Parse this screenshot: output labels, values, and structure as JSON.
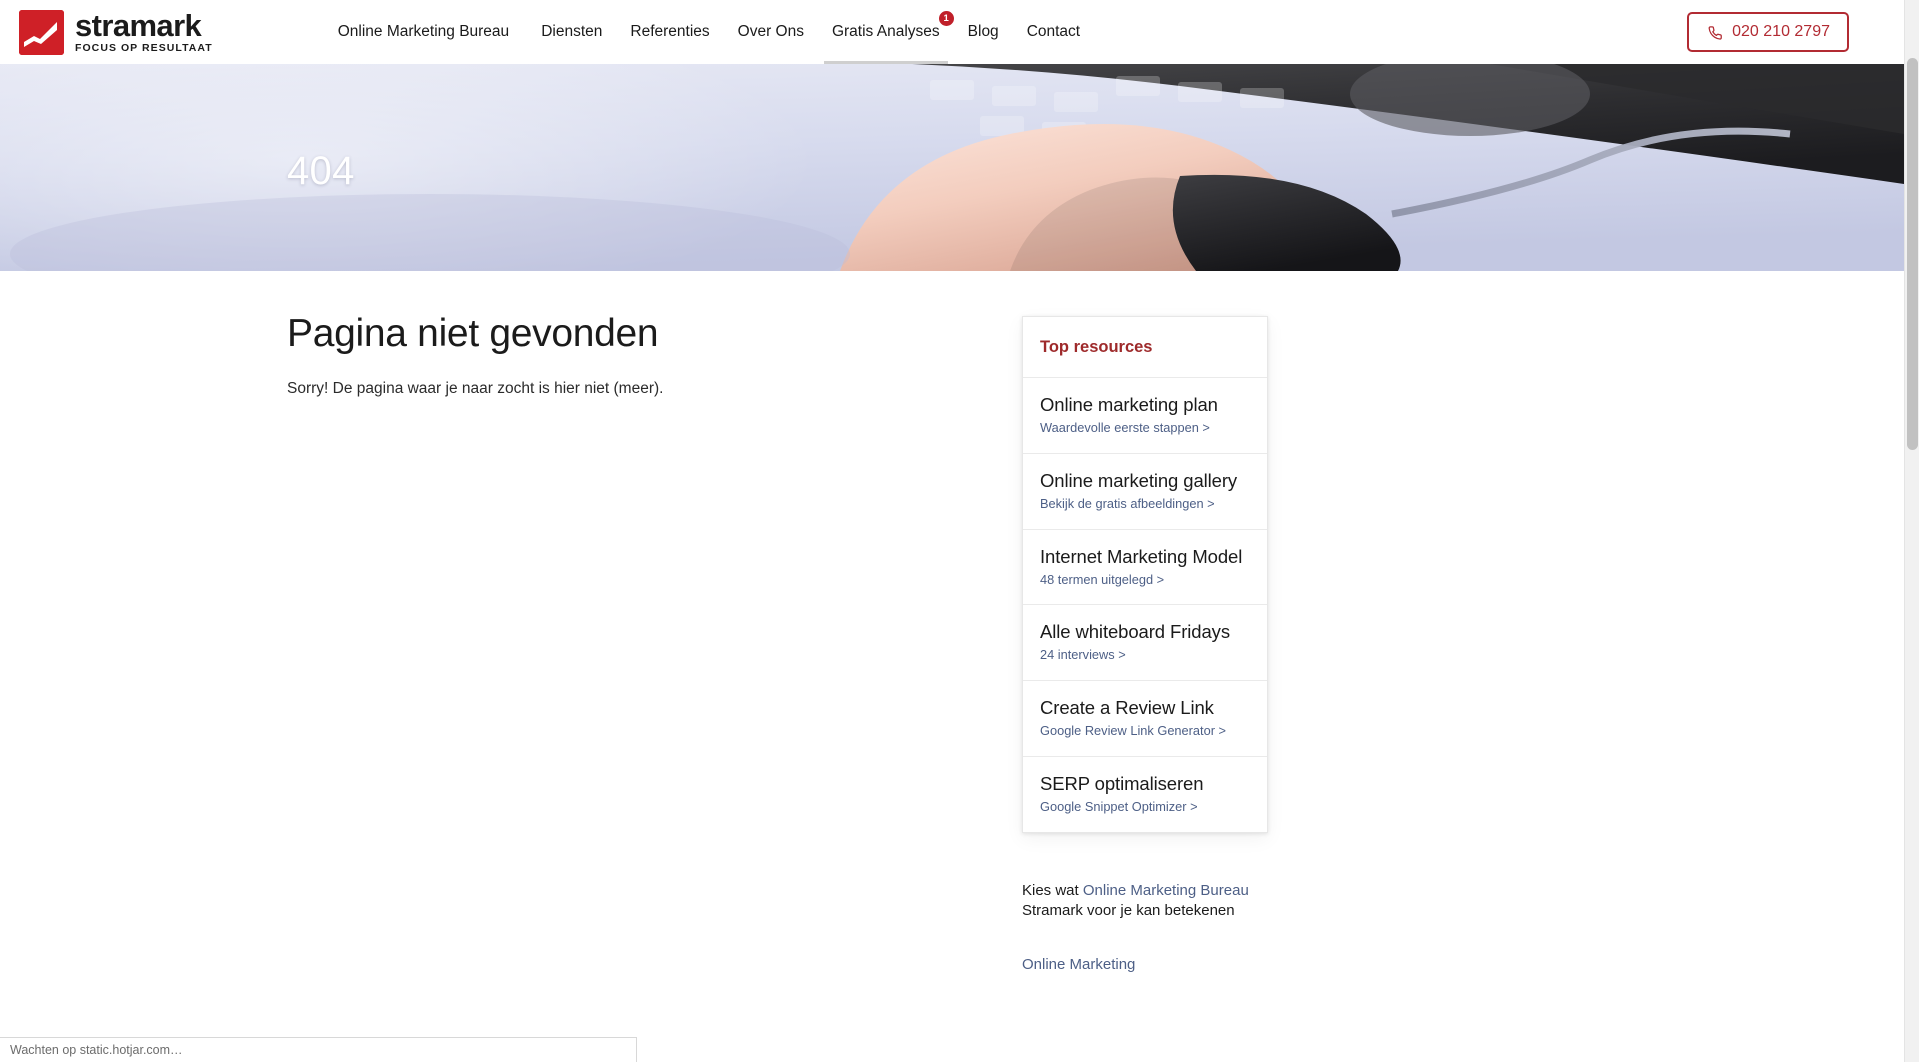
{
  "brand": {
    "name": "stramark",
    "tagline": "FOCUS OP RESULTAAT",
    "logo_color": "#cf2027",
    "accent_color": "#b22b33"
  },
  "header": {
    "nav": [
      {
        "label": "Online Marketing Bureau",
        "active": false,
        "badge": null
      },
      {
        "label": "Diensten",
        "active": false,
        "badge": null
      },
      {
        "label": "Referenties",
        "active": false,
        "badge": null
      },
      {
        "label": "Over Ons",
        "active": false,
        "badge": null
      },
      {
        "label": "Gratis Analyses",
        "active": true,
        "badge": "1"
      },
      {
        "label": "Blog",
        "active": false,
        "badge": null
      },
      {
        "label": "Contact",
        "active": false,
        "badge": null
      }
    ],
    "phone": {
      "number": "020 210 2797",
      "icon": "phone-icon"
    }
  },
  "hero": {
    "title": "404"
  },
  "main": {
    "heading": "Pagina niet gevonden",
    "lead": "Sorry! De pagina waar je naar zocht is hier niet (meer)."
  },
  "sidebar": {
    "card_title": "Top resources",
    "card_title_color": "#9e2a2b",
    "resources": [
      {
        "title": "Online marketing plan",
        "sub": "Waardevolle eerste stappen >"
      },
      {
        "title": "Online marketing gallery",
        "sub": "Bekijk de gratis afbeeldingen >"
      },
      {
        "title": "Internet Marketing Model",
        "sub": "48 termen uitgelegd >"
      },
      {
        "title": "Alle whiteboard Fridays",
        "sub": "24 interviews >"
      },
      {
        "title": "Create a Review Link",
        "sub": "Google Review Link Generator >"
      },
      {
        "title": "SERP optimaliseren",
        "sub": "Google Snippet Optimizer >"
      }
    ],
    "note_prefix": "Kies wat ",
    "note_link": "Online Marketing Bureau",
    "note_suffix": "Stramark voor je kan betekenen",
    "links": [
      {
        "label": "Online Marketing"
      }
    ]
  },
  "status_bar": {
    "text": "Wachten op static.hotjar.com…"
  },
  "scrollbar": {
    "orientation": "vertical"
  }
}
